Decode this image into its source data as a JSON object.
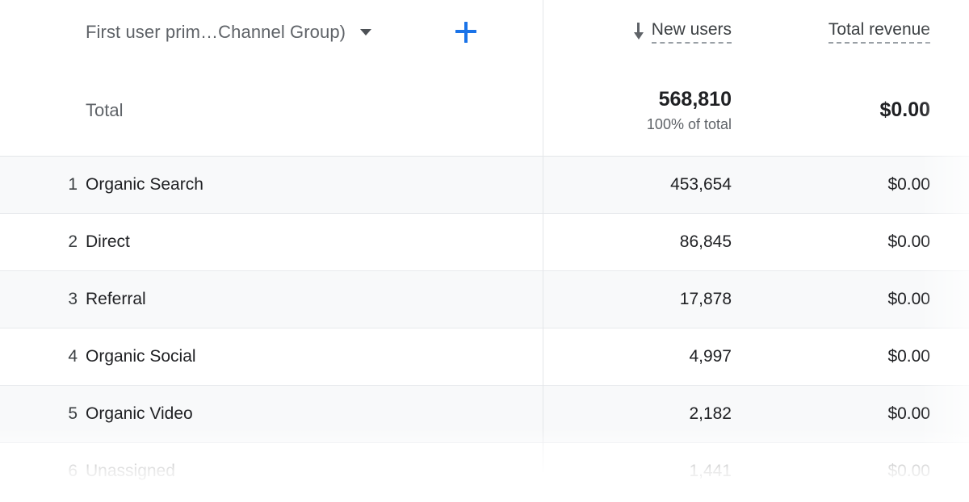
{
  "table": {
    "dimension_header": {
      "label": "First user prim…Channel Group)",
      "caret_icon": "chevron-down-icon",
      "add_icon": "plus-icon",
      "accent_color": "#1a73e8"
    },
    "metric_headers": [
      {
        "label": "New users",
        "sort_icon": "arrow-down-icon",
        "sorted": true
      },
      {
        "label": "Total revenue",
        "sort_icon": "",
        "sorted": false
      }
    ],
    "total_row": {
      "label": "Total",
      "new_users": "568,810",
      "new_users_sub": "100% of total",
      "total_revenue": "$0.00",
      "total_revenue_sub": ""
    },
    "rows": [
      {
        "index": "1",
        "label": "Organic Search",
        "new_users": "453,654",
        "total_revenue": "$0.00"
      },
      {
        "index": "2",
        "label": "Direct",
        "new_users": "86,845",
        "total_revenue": "$0.00"
      },
      {
        "index": "3",
        "label": "Referral",
        "new_users": "17,878",
        "total_revenue": "$0.00"
      },
      {
        "index": "4",
        "label": "Organic Social",
        "new_users": "4,997",
        "total_revenue": "$0.00"
      },
      {
        "index": "5",
        "label": "Organic Video",
        "new_users": "2,182",
        "total_revenue": "$0.00"
      },
      {
        "index": "6",
        "label": "Unassigned",
        "new_users": "1,441",
        "total_revenue": "$0.00"
      }
    ]
  }
}
